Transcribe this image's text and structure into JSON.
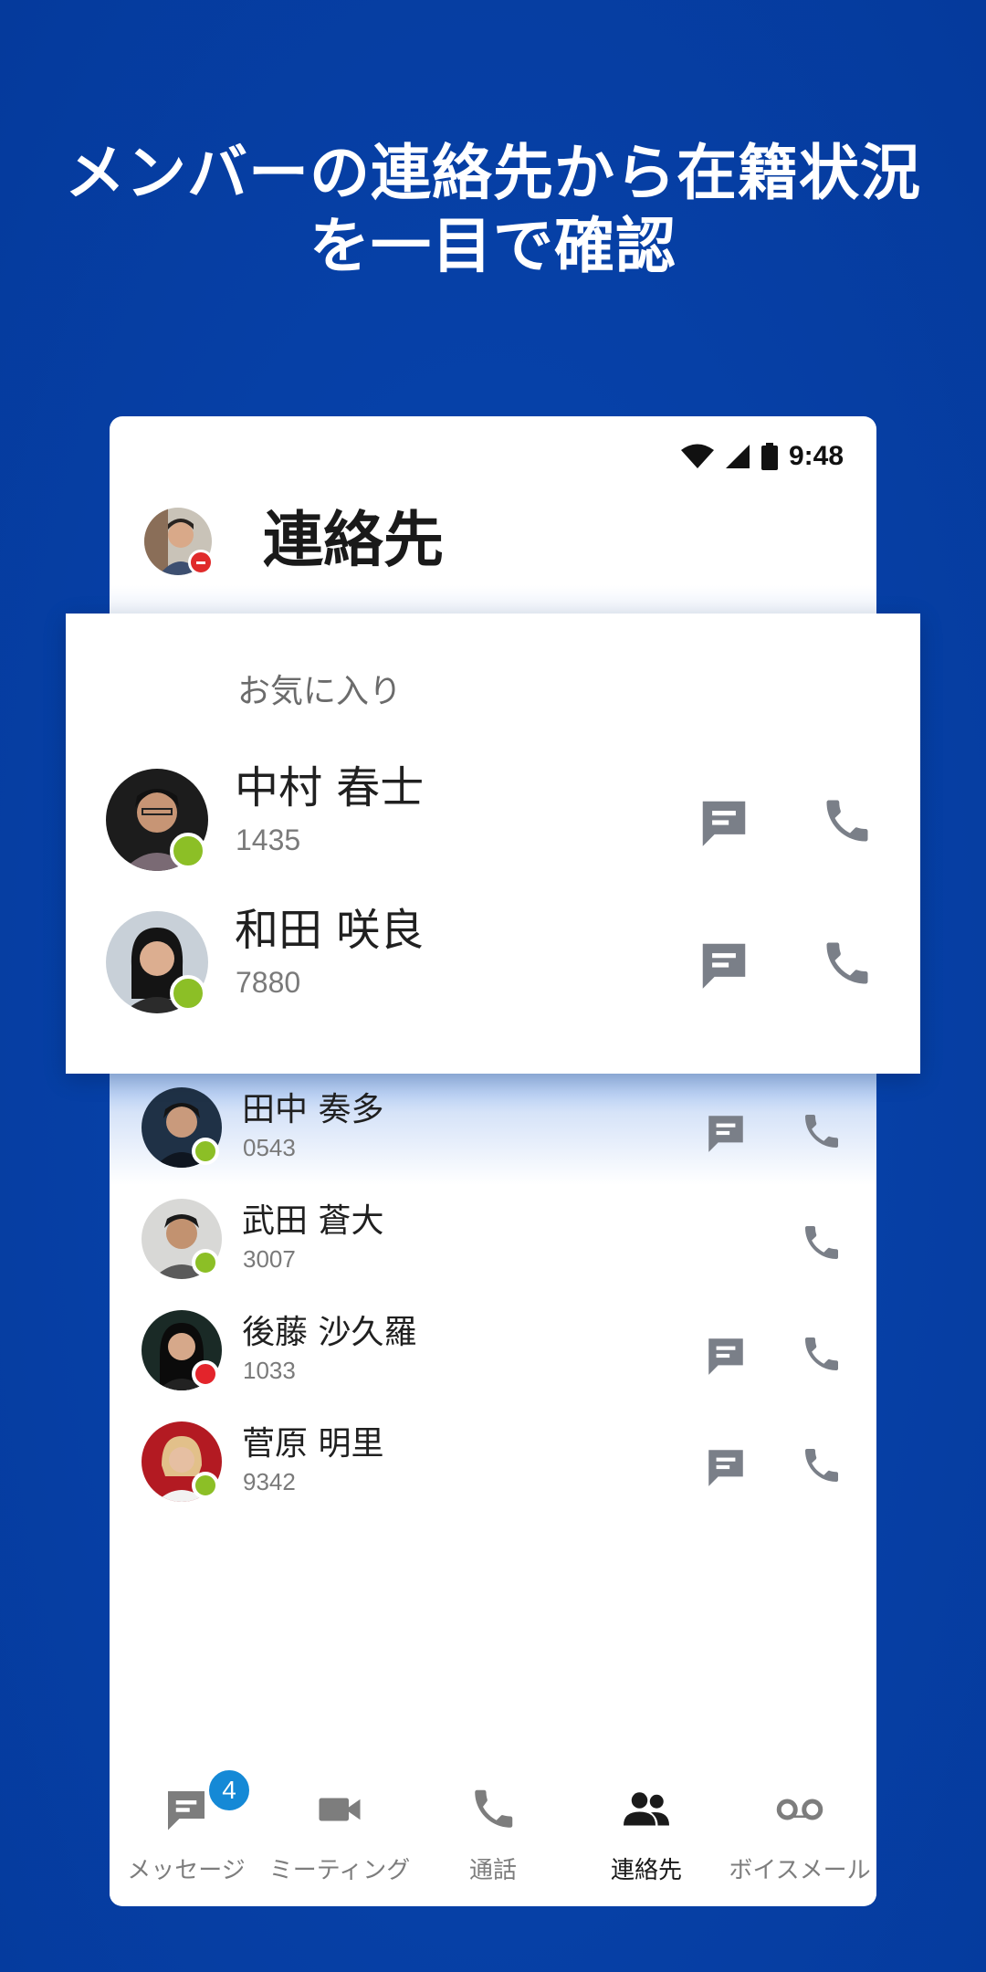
{
  "headline": {
    "line1": "メンバーの連絡先から在籍状況",
    "line2": "を一目で確認"
  },
  "status_bar": {
    "time": "9:48",
    "icons": [
      "wifi-icon",
      "cell-signal-icon",
      "battery-icon"
    ]
  },
  "header": {
    "title": "連絡先",
    "avatar_presence": "busy"
  },
  "favorites": {
    "label": "お気に入り",
    "contacts": [
      {
        "name": "中村 春士",
        "ext": "1435",
        "presence": "available",
        "chat": true
      },
      {
        "name": "和田 咲良",
        "ext": "7880",
        "presence": "available",
        "chat": true
      }
    ]
  },
  "contacts": [
    {
      "name": "田中 奏多",
      "ext": "0543",
      "presence": "available",
      "chat": true
    },
    {
      "name": "武田 蒼大",
      "ext": "3007",
      "presence": "available",
      "chat": false
    },
    {
      "name": "後藤 沙久羅",
      "ext": "1033",
      "presence": "busy",
      "chat": true
    },
    {
      "name": "菅原 明里",
      "ext": "9342",
      "presence": "available",
      "chat": true
    }
  ],
  "nav": {
    "active": "連絡先",
    "items": [
      {
        "label": "メッセージ",
        "icon": "chat-icon",
        "badge": "4"
      },
      {
        "label": "ミーティング",
        "icon": "video-icon"
      },
      {
        "label": "通話",
        "icon": "phone-icon"
      },
      {
        "label": "連絡先",
        "icon": "contacts-icon"
      },
      {
        "label": "ボイスメール",
        "icon": "voicemail-icon"
      }
    ]
  },
  "colors": {
    "background": "#0641a8",
    "available": "#8cbf26",
    "busy": "#e3242b",
    "icon_gray": "#7a7f88",
    "badge": "#1589d6"
  }
}
